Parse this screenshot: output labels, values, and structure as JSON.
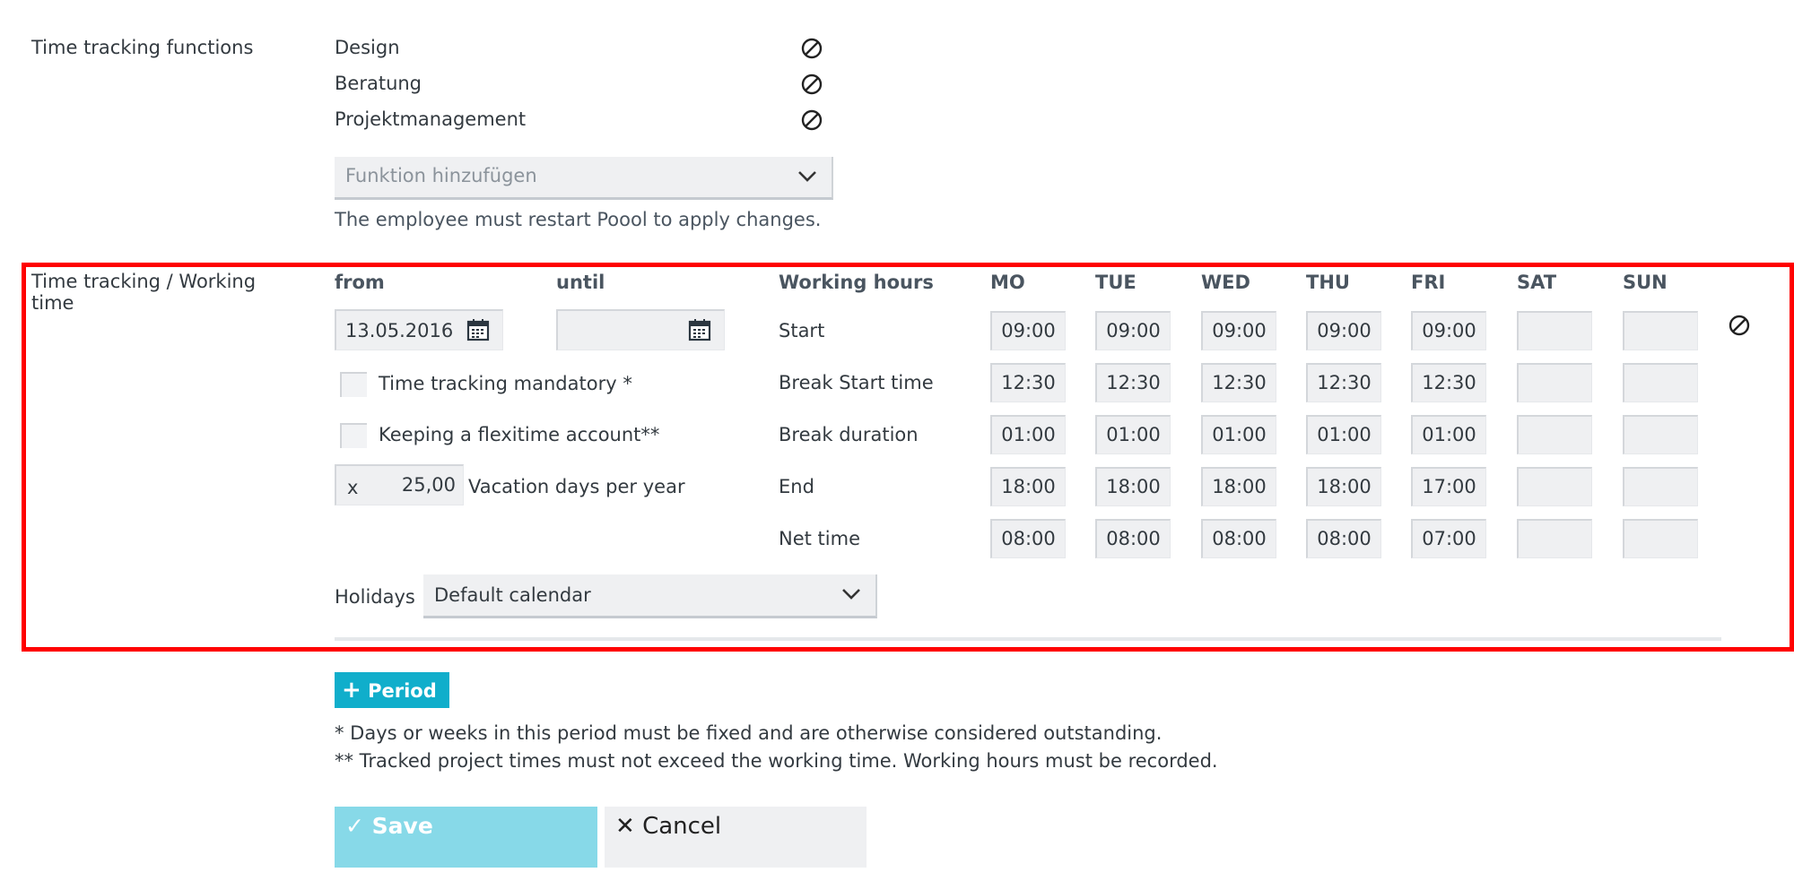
{
  "functions": {
    "label": "Time tracking functions",
    "items": [
      {
        "name": "Design",
        "remove_icon": "ban-icon"
      },
      {
        "name": "Beratung",
        "remove_icon": "ban-icon"
      },
      {
        "name": "Projektmanagement",
        "remove_icon": "ban-icon"
      }
    ],
    "add_placeholder": "Funktion hinzufügen",
    "restart_note": "The employee must restart Poool to apply changes."
  },
  "working_time": {
    "label": "Time tracking / Working time",
    "from_label": "from",
    "from_value": "13.05.2016",
    "until_label": "until",
    "until_value": "",
    "calendar_icon": "calendar-icon",
    "mandatory_label": "Time tracking mandatory *",
    "mandatory_checked": false,
    "flexitime_label": "Keeping a flexitime account**",
    "flexitime_checked": false,
    "vacation_prefix": "x",
    "vacation_value": "25,00",
    "vacation_label": "Vacation days per year",
    "holidays_label": "Holidays",
    "holidays_value": "Default calendar",
    "schedule": {
      "header_label": "Working hours",
      "days": [
        "MO",
        "TUE",
        "WED",
        "THU",
        "FRI",
        "SAT",
        "SUN"
      ],
      "rows": [
        {
          "label": "Start",
          "values": [
            "09:00",
            "09:00",
            "09:00",
            "09:00",
            "09:00",
            "",
            ""
          ]
        },
        {
          "label": "Break Start time",
          "values": [
            "12:30",
            "12:30",
            "12:30",
            "12:30",
            "12:30",
            "",
            ""
          ]
        },
        {
          "label": "Break duration",
          "values": [
            "01:00",
            "01:00",
            "01:00",
            "01:00",
            "01:00",
            "",
            ""
          ]
        },
        {
          "label": "End",
          "values": [
            "18:00",
            "18:00",
            "18:00",
            "18:00",
            "17:00",
            "",
            ""
          ]
        },
        {
          "label": "Net time",
          "values": [
            "08:00",
            "08:00",
            "08:00",
            "08:00",
            "07:00",
            "",
            ""
          ]
        }
      ]
    },
    "highlight_color": "#ff0000"
  },
  "period_button": {
    "icon": "plus-icon",
    "label": "Period",
    "color": "#10aecb"
  },
  "footnotes": [
    "* Days or weeks in this period must be fixed and are otherwise considered outstanding.",
    "** Tracked project times must not exceed the working time. Working hours must be recorded."
  ],
  "actions": {
    "save": {
      "icon": "check-icon",
      "label": "Save",
      "color": "#87d9e8"
    },
    "cancel": {
      "icon": "close-icon",
      "label": "Cancel"
    }
  }
}
